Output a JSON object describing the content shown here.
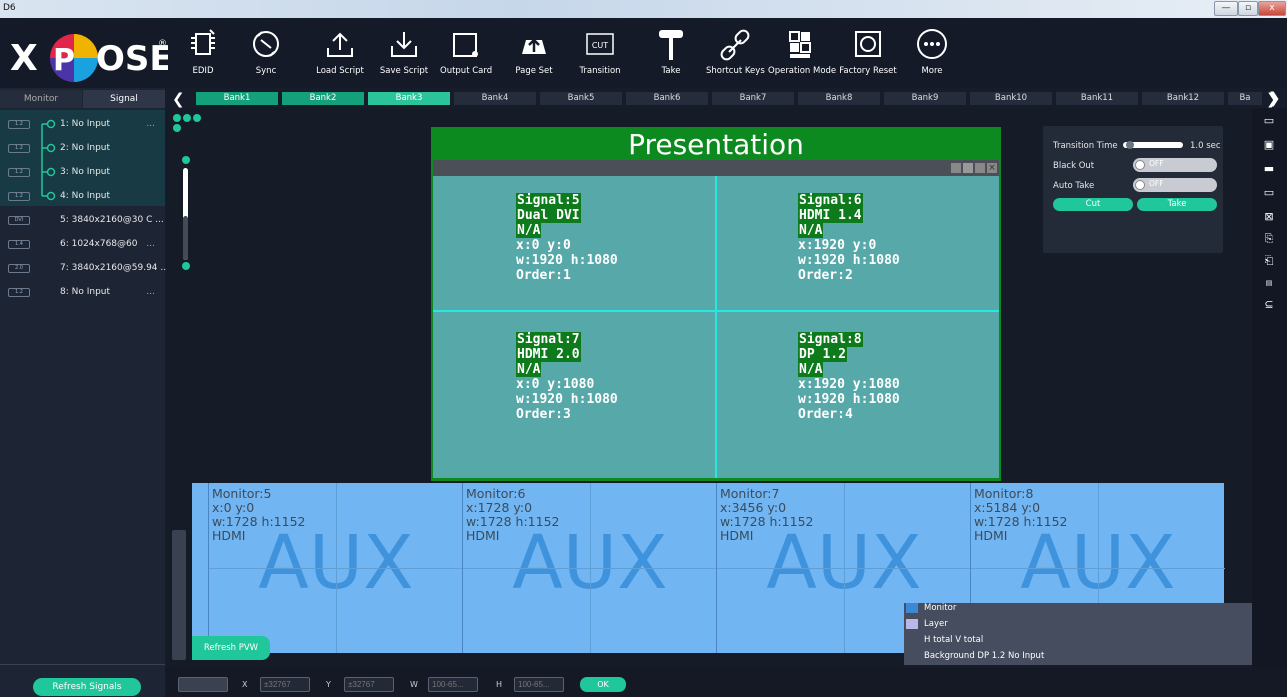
{
  "window": {
    "title": "D6",
    "min": "—",
    "max": "▫",
    "close": "x"
  },
  "logo": {
    "text": "XPOSE"
  },
  "toolbar": {
    "items": [
      {
        "label": "EDID",
        "icon": "chip-icon"
      },
      {
        "label": "Sync",
        "icon": "sync-icon"
      },
      {
        "label": "Load Script",
        "icon": "upload-tray-icon"
      },
      {
        "label": "Save Script",
        "icon": "download-tray-icon"
      },
      {
        "label": "Output Card",
        "icon": "output-card-icon"
      },
      {
        "label": "Page Set",
        "icon": "cloud-upload-icon"
      },
      {
        "label": "Transition",
        "icon": "cut-box-icon",
        "badge": "CUT"
      },
      {
        "label": "Take",
        "icon": "take-lever-icon"
      },
      {
        "label": "Shortcut Keys",
        "icon": "link-icon"
      },
      {
        "label": "Operation Mode",
        "icon": "grid-mode-icon"
      },
      {
        "label": "Factory Reset",
        "icon": "reset-icon"
      },
      {
        "label": "More",
        "icon": "more-dots-icon"
      }
    ]
  },
  "left": {
    "tabs": [
      {
        "label": "Monitor"
      },
      {
        "label": "Signal"
      }
    ],
    "signals": [
      {
        "label": "1: No Input",
        "port": "1.2",
        "dots": "..."
      },
      {
        "label": "2: No Input",
        "port": "1.2",
        "dots": ""
      },
      {
        "label": "3: No Input",
        "port": "1.2",
        "dots": ""
      },
      {
        "label": "4: No Input",
        "port": "1.2",
        "dots": ""
      },
      {
        "label": "5: 3840x2160@30 C ...",
        "port": "DVI",
        "dots": ""
      },
      {
        "label": "6: 1024x768@60",
        "port": "1.4",
        "dots": "..."
      },
      {
        "label": "7: 3840x2160@59.94 ...",
        "port": "2.0",
        "dots": ""
      },
      {
        "label": "8: No Input",
        "port": "1.2",
        "dots": "..."
      }
    ],
    "refresh": "Refresh Signals"
  },
  "banks": [
    "Bank1",
    "Bank2",
    "Bank3",
    "Bank4",
    "Bank5",
    "Bank6",
    "Bank7",
    "Bank8",
    "Bank9",
    "Bank10",
    "Bank11",
    "Bank12",
    "Ba"
  ],
  "presentation": {
    "title": "Presentation",
    "windows": [
      {
        "signal": "Signal:5",
        "type": "Dual DVI",
        "res": "N/A",
        "pos": "x:0  y:0",
        "size": "w:1920  h:1080",
        "order": "Order:1"
      },
      {
        "signal": "Signal:6",
        "type": "HDMI 1.4",
        "res": "N/A",
        "pos": "x:1920  y:0",
        "size": "w:1920  h:1080",
        "order": "Order:2"
      },
      {
        "signal": "Signal:7",
        "type": "HDMI 2.0",
        "res": "N/A",
        "pos": "x:0  y:1080",
        "size": "w:1920  h:1080",
        "order": "Order:3"
      },
      {
        "signal": "Signal:8",
        "type": "DP 1.2",
        "res": "N/A",
        "pos": "x:1920  y:1080",
        "size": "w:1920  h:1080",
        "order": "Order:4"
      }
    ]
  },
  "transition": {
    "time_label": "Transition Time",
    "time_value": "1.0 sec",
    "blackout_label": "Black Out",
    "blackout_state": "OFF",
    "autotake_label": "Auto Take",
    "autotake_state": "OFF",
    "cut": "Cut",
    "take": "Take"
  },
  "monitors": [
    {
      "name": "Monitor:5",
      "pos": "x:0  y:0",
      "size": "w:1728  h:1152",
      "type": "HDMI",
      "label": "AUX"
    },
    {
      "name": "Monitor:6",
      "pos": "x:1728  y:0",
      "size": "w:1728  h:1152",
      "type": "HDMI",
      "label": "AUX"
    },
    {
      "name": "Monitor:7",
      "pos": "x:3456  y:0",
      "size": "w:1728  h:1152",
      "type": "HDMI",
      "label": "AUX"
    },
    {
      "name": "Monitor:8",
      "pos": "x:5184  y:0",
      "size": "w:1728  h:1152",
      "type": "HDMI",
      "label": "AUX"
    }
  ],
  "context": {
    "monitor": "Monitor",
    "layer": "Layer",
    "htotal": "H total V total",
    "background": "Background  DP 1.2 No Input"
  },
  "refresh_pvw": "Refresh PVW",
  "bottom": {
    "x_label": "X",
    "x_ph": "±32767",
    "y_label": "Y",
    "y_ph": "±32767",
    "w_label": "W",
    "w_ph": "100-65...",
    "h_label": "H",
    "h_ph": "100-65...",
    "ok": "OK"
  },
  "colors": {
    "accent": "#1fc79a",
    "canvas": "#161b28",
    "monitor": "#71b6f2",
    "preset_green": "#0d8a1f",
    "window_fill": "#57a9a9"
  }
}
